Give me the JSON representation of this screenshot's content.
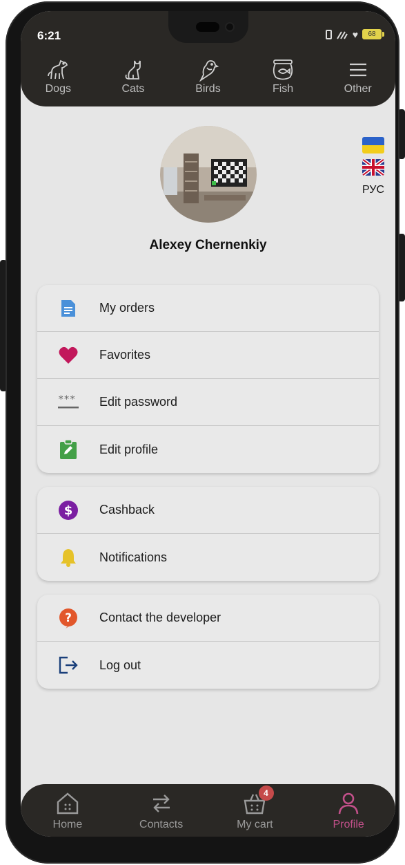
{
  "status_bar": {
    "time": "6:21",
    "battery": "68"
  },
  "category_nav": [
    {
      "label": "Dogs",
      "icon": "dog-icon"
    },
    {
      "label": "Cats",
      "icon": "cat-icon"
    },
    {
      "label": "Birds",
      "icon": "bird-icon"
    },
    {
      "label": "Fish",
      "icon": "fish-icon"
    },
    {
      "label": "Other",
      "icon": "menu-icon"
    }
  ],
  "language": {
    "current_label": "РУС",
    "flags": [
      "ukraine-flag",
      "uk-flag"
    ]
  },
  "profile": {
    "name": "Alexey Chernenkiy"
  },
  "menu_groups": [
    [
      {
        "label": "My orders",
        "icon": "document-icon",
        "color": "#4a90d9"
      },
      {
        "label": "Favorites",
        "icon": "heart-icon",
        "color": "#c2185b"
      },
      {
        "label": "Edit password",
        "icon": "password-icon",
        "color": "#666666"
      },
      {
        "label": "Edit profile",
        "icon": "clipboard-edit-icon",
        "color": "#43a047"
      }
    ],
    [
      {
        "label": "Cashback",
        "icon": "dollar-icon",
        "color": "#7b1fa2"
      },
      {
        "label": "Notifications",
        "icon": "bell-icon",
        "color": "#e6c229"
      }
    ],
    [
      {
        "label": "Contact the developer",
        "icon": "help-icon",
        "color": "#e2572b"
      },
      {
        "label": "Log out",
        "icon": "logout-icon",
        "color": "#1a3f7a"
      }
    ]
  ],
  "bottom_nav": [
    {
      "label": "Home",
      "icon": "home-icon",
      "active": false
    },
    {
      "label": "Contacts",
      "icon": "contacts-icon",
      "active": false
    },
    {
      "label": "My cart",
      "icon": "cart-icon",
      "active": false,
      "badge": "4"
    },
    {
      "label": "Profile",
      "icon": "profile-icon",
      "active": true
    }
  ],
  "colors": {
    "header_bg": "#2a2825",
    "screen_bg": "#e6e6e6",
    "active_tab": "#c2508a",
    "badge": "#c54a4a"
  }
}
